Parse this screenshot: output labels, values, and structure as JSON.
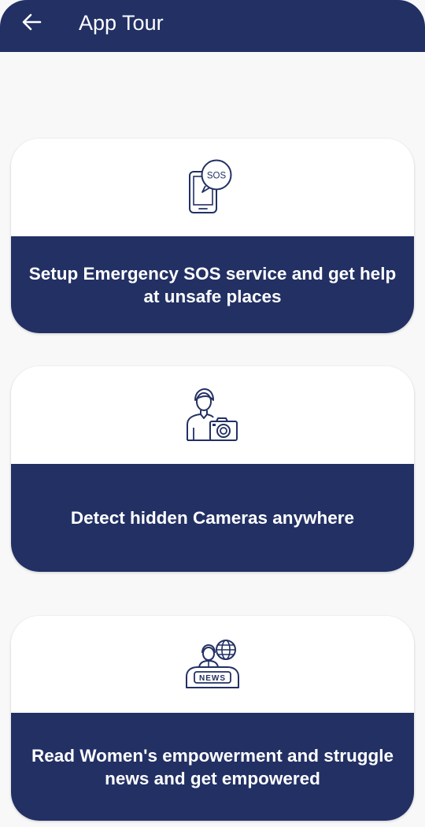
{
  "header": {
    "title": "App Tour",
    "back_icon": "arrow-left-icon"
  },
  "colors": {
    "primary": "#223064",
    "background": "#f8f8f8",
    "card": "#ffffff",
    "text_on_primary": "#ffffff"
  },
  "cards": [
    {
      "icon": "sos-phone-icon",
      "icon_text": "SOS",
      "line1": "Setup Emergency SOS service and get help",
      "line2": "at unsafe places"
    },
    {
      "icon": "person-camera-icon",
      "line1": "Detect hidden Cameras anywhere"
    },
    {
      "icon": "news-reporter-icon",
      "icon_text": "NEWS",
      "line1": "Read Women's empowerment and struggle",
      "line2": "news and get empowered"
    }
  ]
}
